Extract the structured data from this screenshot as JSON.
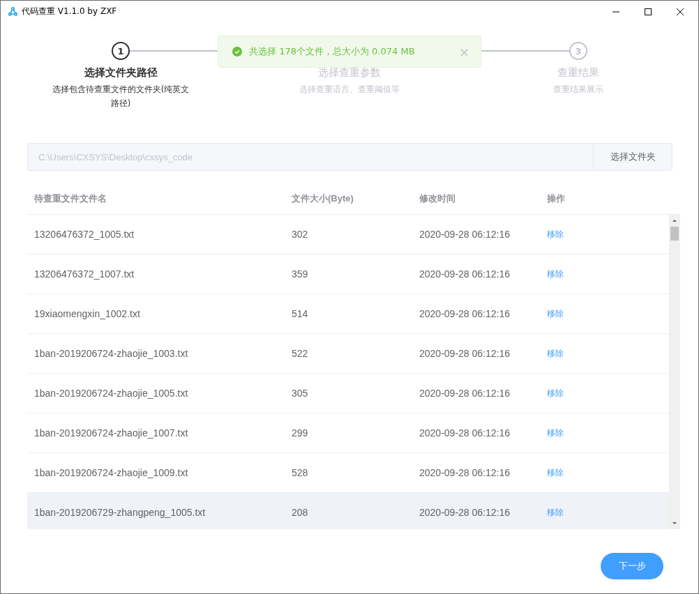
{
  "window": {
    "title": "代码查重 V1.1.0 by ZXF"
  },
  "steps": [
    {
      "number": "1",
      "title": "选择文件夹路径",
      "description": "选择包含待查重文件的文件夹(纯英文路径)",
      "active": true
    },
    {
      "title": "选择查重参数",
      "description": "选择查重语言、查重阈值等",
      "active": false
    },
    {
      "number": "3",
      "title": "查重结果",
      "description": "查重结果展示",
      "active": false
    }
  ],
  "toast": {
    "message": "共选择 178个文件，总大小为 0.074 MB",
    "close": "×"
  },
  "path": {
    "value": "C:\\Users\\CXSYS\\Desktop\\cxsys_code",
    "disabled": true,
    "button": "选择文件夹"
  },
  "table": {
    "columns": [
      "待查重文件文件名",
      "文件大小(Byte)",
      "修改时间",
      "操作"
    ],
    "rows": [
      {
        "name": "13206476372_1005.txt",
        "size": "302",
        "time": "2020-09-28 06:12:16",
        "action": "移除",
        "highlighted": false
      },
      {
        "name": "13206476372_1007.txt",
        "size": "359",
        "time": "2020-09-28 06:12:16",
        "action": "移除",
        "highlighted": false
      },
      {
        "name": "19xiaomengxin_1002.txt",
        "size": "514",
        "time": "2020-09-28 06:12:16",
        "action": "移除",
        "highlighted": false
      },
      {
        "name": "1ban-2019206724-zhaojie_1003.txt",
        "size": "522",
        "time": "2020-09-28 06:12:16",
        "action": "移除",
        "highlighted": false
      },
      {
        "name": "1ban-2019206724-zhaojie_1005.txt",
        "size": "305",
        "time": "2020-09-28 06:12:16",
        "action": "移除",
        "highlighted": false
      },
      {
        "name": "1ban-2019206724-zhaojie_1007.txt",
        "size": "299",
        "time": "2020-09-28 06:12:16",
        "action": "移除",
        "highlighted": false
      },
      {
        "name": "1ban-2019206724-zhaojie_1009.txt",
        "size": "528",
        "time": "2020-09-28 06:12:16",
        "action": "移除",
        "highlighted": false
      },
      {
        "name": "1ban-2019206729-zhangpeng_1005.txt",
        "size": "208",
        "time": "2020-09-28 06:12:16",
        "action": "移除",
        "highlighted": true
      }
    ]
  },
  "next_button": "下一步"
}
